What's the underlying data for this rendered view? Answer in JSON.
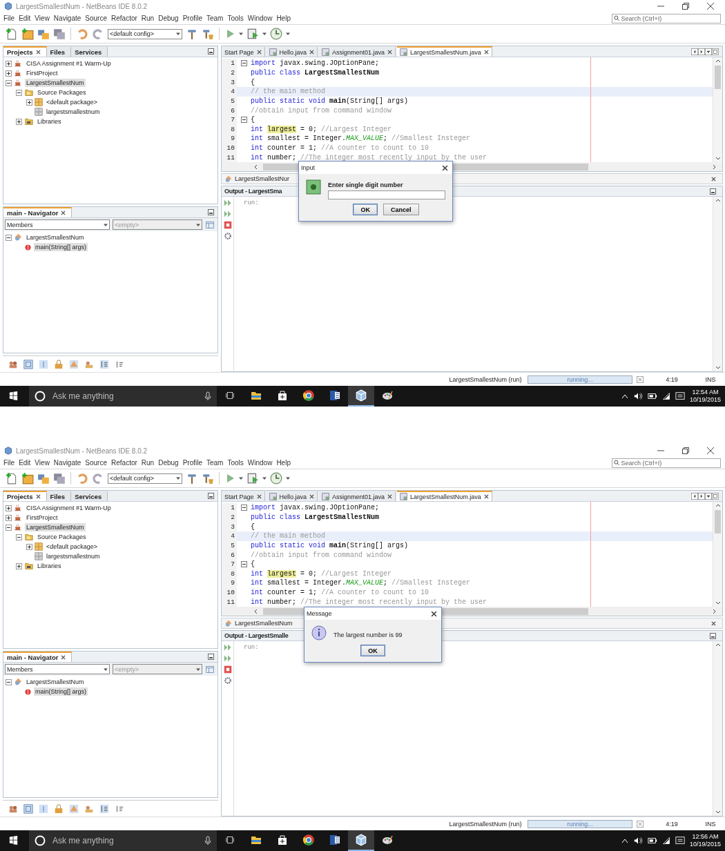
{
  "screens": [
    {
      "window": {
        "title": "LargestSmallestNum - NetBeans IDE 8.0.2"
      },
      "menu": [
        "File",
        "Edit",
        "View",
        "Navigate",
        "Source",
        "Refactor",
        "Run",
        "Debug",
        "Profile",
        "Team",
        "Tools",
        "Window",
        "Help"
      ],
      "search": {
        "placeholder": "Search (Ctrl+I)"
      },
      "toolbar": {
        "config": "<default config>"
      },
      "project_tabs": [
        {
          "label": "Projects",
          "selected": true
        },
        {
          "label": "Files",
          "selected": false
        },
        {
          "label": "Services",
          "selected": false
        }
      ],
      "project_tree": [
        {
          "label": "CISA Assignment #1  Warm-Up",
          "kind": "project",
          "expanded": false,
          "selected": false
        },
        {
          "label": "FirstProject",
          "kind": "project",
          "expanded": false,
          "selected": false
        },
        {
          "label": "LargestSmallestNum",
          "kind": "project",
          "expanded": true,
          "selected": true,
          "children": [
            {
              "label": "Source Packages",
              "kind": "folder",
              "expanded": true,
              "selected": false,
              "children": [
                {
                  "label": "<default package>",
                  "kind": "package",
                  "expanded": false,
                  "selected": false
                },
                {
                  "label": "largestsmallestnum",
                  "kind": "empty-package",
                  "selected": false
                }
              ]
            },
            {
              "label": "Libraries",
              "kind": "library",
              "expanded": false,
              "selected": false
            }
          ]
        }
      ],
      "navigator": {
        "title": "main - Navigator",
        "filter": "Members",
        "member": "<empty>",
        "tree": [
          {
            "label": "LargestSmallestNum",
            "kind": "class",
            "expanded": true,
            "selected": false,
            "children": [
              {
                "label": "main(String[] args)",
                "kind": "method",
                "selected": true
              }
            ]
          }
        ]
      },
      "editor_tabs": [
        {
          "label": "Start Page",
          "kind": "page",
          "selected": false
        },
        {
          "label": "Hello.java",
          "kind": "java",
          "selected": false
        },
        {
          "label": "Assignment01.java",
          "kind": "java",
          "selected": false
        },
        {
          "label": "LargestSmallestNum.java",
          "kind": "java",
          "selected": true
        }
      ],
      "code": [
        {
          "number": "1",
          "fold": true,
          "current": false,
          "tokens": [
            {
              "kind": "keyword",
              "text": "import"
            },
            {
              "kind": "plain",
              "text": " javax.swing.JOptionPane;"
            }
          ]
        },
        {
          "number": "2",
          "fold": false,
          "current": false,
          "tokens": [
            {
              "kind": "keyword",
              "text": "public class "
            },
            {
              "kind": "bold",
              "text": "LargestSmallestNum"
            }
          ]
        },
        {
          "number": "3",
          "fold": false,
          "current": false,
          "tokens": [
            {
              "kind": "plain",
              "text": "{"
            }
          ]
        },
        {
          "number": "4",
          "fold": false,
          "current": true,
          "tokens": [
            {
              "kind": "comment",
              "text": "// the main method"
            }
          ]
        },
        {
          "number": "5",
          "fold": false,
          "current": false,
          "tokens": [
            {
              "kind": "keyword",
              "text": "public static void "
            },
            {
              "kind": "bold",
              "text": "main"
            },
            {
              "kind": "plain",
              "text": "(String[] args)"
            }
          ]
        },
        {
          "number": "6",
          "fold": false,
          "current": false,
          "tokens": [
            {
              "kind": "comment",
              "text": "//obtain input from command window"
            }
          ]
        },
        {
          "number": "7",
          "fold": true,
          "current": false,
          "tokens": [
            {
              "kind": "plain",
              "text": "{"
            }
          ]
        },
        {
          "number": "8",
          "fold": false,
          "current": false,
          "tokens": [
            {
              "kind": "keyword",
              "text": "int "
            },
            {
              "kind": "marked",
              "text": "largest"
            },
            {
              "kind": "plain",
              "text": " = 0; "
            },
            {
              "kind": "comment",
              "text": "//Largest Integer"
            }
          ]
        },
        {
          "number": "9",
          "fold": false,
          "current": false,
          "tokens": [
            {
              "kind": "keyword",
              "text": "int"
            },
            {
              "kind": "plain",
              "text": " smallest = Integer."
            },
            {
              "kind": "field",
              "text": "MAX_VALUE"
            },
            {
              "kind": "plain",
              "text": "; "
            },
            {
              "kind": "comment",
              "text": "//Smallest Insteger"
            }
          ]
        },
        {
          "number": "10",
          "fold": false,
          "current": false,
          "tokens": [
            {
              "kind": "keyword",
              "text": "int"
            },
            {
              "kind": "plain",
              "text": " counter = 1; "
            },
            {
              "kind": "comment",
              "text": "//A counter to count to 10"
            }
          ]
        },
        {
          "number": "11",
          "fold": false,
          "current": false,
          "tokens": [
            {
              "kind": "keyword",
              "text": "int"
            },
            {
              "kind": "plain",
              "text": " number; "
            },
            {
              "kind": "comment",
              "text": "//The integer most recently input by the user"
            }
          ]
        }
      ],
      "breadcrumb": "LargestSmallestNur",
      "output": {
        "title": "Output - LargestSma",
        "text": "run:"
      },
      "dialog": {
        "kind": "input",
        "title": "Input",
        "message": "Enter single digit number",
        "buttons": [
          {
            "label": "OK",
            "selected": true
          },
          {
            "label": "Cancel",
            "selected": false
          }
        ]
      },
      "status": {
        "task": "LargestSmallestNum (run)",
        "progress": "running...",
        "level": 1,
        "position": "4:19",
        "mode": "INS"
      },
      "taskbar": {
        "placeholder": "Ask me anything",
        "time": "12:54 AM",
        "date": "10/19/2015"
      }
    },
    {
      "window": {
        "title": "LargestSmallestNum - NetBeans IDE 8.0.2"
      },
      "menu": [
        "File",
        "Edit",
        "View",
        "Navigate",
        "Source",
        "Refactor",
        "Run",
        "Debug",
        "Profile",
        "Team",
        "Tools",
        "Window",
        "Help"
      ],
      "search": {
        "placeholder": "Search (Ctrl+I)"
      },
      "toolbar": {
        "config": "<default config>"
      },
      "project_tabs": [
        {
          "label": "Projects",
          "selected": true
        },
        {
          "label": "Files",
          "selected": false
        },
        {
          "label": "Services",
          "selected": false
        }
      ],
      "project_tree": [
        {
          "label": "CISA Assignment #1  Warm-Up",
          "kind": "project",
          "expanded": false,
          "selected": false
        },
        {
          "label": "FirstProject",
          "kind": "project",
          "expanded": false,
          "selected": false
        },
        {
          "label": "LargestSmallestNum",
          "kind": "project",
          "expanded": true,
          "selected": true,
          "children": [
            {
              "label": "Source Packages",
              "kind": "folder",
              "expanded": true,
              "selected": false,
              "children": [
                {
                  "label": "<default package>",
                  "kind": "package",
                  "expanded": false,
                  "selected": false
                },
                {
                  "label": "largestsmallestnum",
                  "kind": "empty-package",
                  "selected": false
                }
              ]
            },
            {
              "label": "Libraries",
              "kind": "library",
              "expanded": false,
              "selected": false
            }
          ]
        }
      ],
      "navigator": {
        "title": "main - Navigator",
        "filter": "Members",
        "member": "<empty>",
        "tree": [
          {
            "label": "LargestSmallestNum",
            "kind": "class",
            "expanded": true,
            "selected": false,
            "children": [
              {
                "label": "main(String[] args)",
                "kind": "method",
                "selected": true
              }
            ]
          }
        ]
      },
      "editor_tabs": [
        {
          "label": "Start Page",
          "kind": "page",
          "selected": false
        },
        {
          "label": "Hello.java",
          "kind": "java",
          "selected": false
        },
        {
          "label": "Assignment01.java",
          "kind": "java",
          "selected": false
        },
        {
          "label": "LargestSmallestNum.java",
          "kind": "java",
          "selected": true
        }
      ],
      "code": [
        {
          "number": "1",
          "fold": true,
          "current": false,
          "tokens": [
            {
              "kind": "keyword",
              "text": "import"
            },
            {
              "kind": "plain",
              "text": " javax.swing.JOptionPane;"
            }
          ]
        },
        {
          "number": "2",
          "fold": false,
          "current": false,
          "tokens": [
            {
              "kind": "keyword",
              "text": "public class "
            },
            {
              "kind": "bold",
              "text": "LargestSmallestNum"
            }
          ]
        },
        {
          "number": "3",
          "fold": false,
          "current": false,
          "tokens": [
            {
              "kind": "plain",
              "text": "{"
            }
          ]
        },
        {
          "number": "4",
          "fold": false,
          "current": true,
          "tokens": [
            {
              "kind": "comment",
              "text": "// the main method"
            }
          ]
        },
        {
          "number": "5",
          "fold": false,
          "current": false,
          "tokens": [
            {
              "kind": "keyword",
              "text": "public static void "
            },
            {
              "kind": "bold",
              "text": "main"
            },
            {
              "kind": "plain",
              "text": "(String[] args)"
            }
          ]
        },
        {
          "number": "6",
          "fold": false,
          "current": false,
          "tokens": [
            {
              "kind": "comment",
              "text": "//obtain input from command window"
            }
          ]
        },
        {
          "number": "7",
          "fold": true,
          "current": false,
          "tokens": [
            {
              "kind": "plain",
              "text": "{"
            }
          ]
        },
        {
          "number": "8",
          "fold": false,
          "current": false,
          "tokens": [
            {
              "kind": "keyword",
              "text": "int "
            },
            {
              "kind": "marked",
              "text": "largest"
            },
            {
              "kind": "plain",
              "text": " = 0; "
            },
            {
              "kind": "comment",
              "text": "//Largest Integer"
            }
          ]
        },
        {
          "number": "9",
          "fold": false,
          "current": false,
          "tokens": [
            {
              "kind": "keyword",
              "text": "int"
            },
            {
              "kind": "plain",
              "text": " smallest = Integer."
            },
            {
              "kind": "field",
              "text": "MAX_VALUE"
            },
            {
              "kind": "plain",
              "text": "; "
            },
            {
              "kind": "comment",
              "text": "//Smallest Insteger"
            }
          ]
        },
        {
          "number": "10",
          "fold": false,
          "current": false,
          "tokens": [
            {
              "kind": "keyword",
              "text": "int"
            },
            {
              "kind": "plain",
              "text": " counter = 1; "
            },
            {
              "kind": "comment",
              "text": "//A counter to count to 10"
            }
          ]
        },
        {
          "number": "11",
          "fold": false,
          "current": false,
          "tokens": [
            {
              "kind": "keyword",
              "text": "int"
            },
            {
              "kind": "plain",
              "text": " number; "
            },
            {
              "kind": "comment",
              "text": "//The integer most recently input by the user"
            }
          ]
        }
      ],
      "breadcrumb": "LargestSmallestNum",
      "output": {
        "title": "Output - LargestSmalle",
        "text": "run:"
      },
      "dialog": {
        "kind": "message",
        "title": "Message",
        "message": "The largest number is 99",
        "buttons": [
          {
            "label": "OK",
            "selected": true
          }
        ]
      },
      "status": {
        "task": "LargestSmallestNum (run)",
        "progress": "running...",
        "level": 1,
        "position": "4:19",
        "mode": "INS"
      },
      "taskbar": {
        "placeholder": "Ask me anything",
        "time": "12:56 AM",
        "date": "10/19/2015"
      }
    }
  ]
}
